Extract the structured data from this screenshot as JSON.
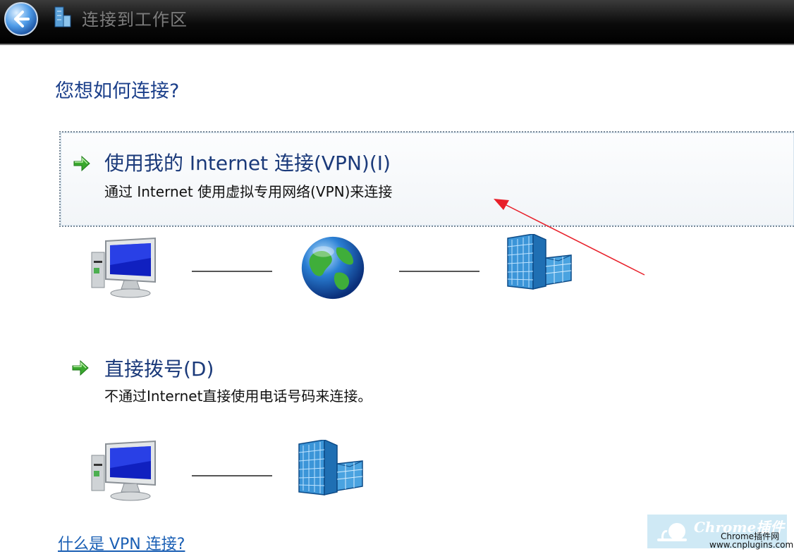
{
  "window": {
    "title": "连接到工作区",
    "back_icon": "back-arrow-icon",
    "title_icon": "network-workplace-icon"
  },
  "main": {
    "heading": "您想如何连接?",
    "options": [
      {
        "title": "使用我的 Internet 连接(VPN)(I)",
        "description": "通过 Internet 使用虚拟专用网络(VPN)来连接",
        "icon": "green-arrow-icon",
        "diagram": [
          "computer-icon",
          "globe-icon",
          "office-building-icon"
        ]
      },
      {
        "title": "直接拨号(D)",
        "description": "不通过Internet直接使用电话号码来连接。",
        "icon": "green-arrow-icon",
        "diagram": [
          "computer-icon",
          "office-building-icon"
        ]
      }
    ],
    "help_link": "什么是 VPN 连接?"
  },
  "annotation": {
    "color": "#e8202a"
  },
  "watermark": {
    "brand": "Chrome插件",
    "subtitle": "Chrome插件网",
    "url": "www.cnplugins.com"
  },
  "colors": {
    "accent": "#1b3f8a",
    "link": "#1a5fb4",
    "arrow": "#3aa82e"
  }
}
